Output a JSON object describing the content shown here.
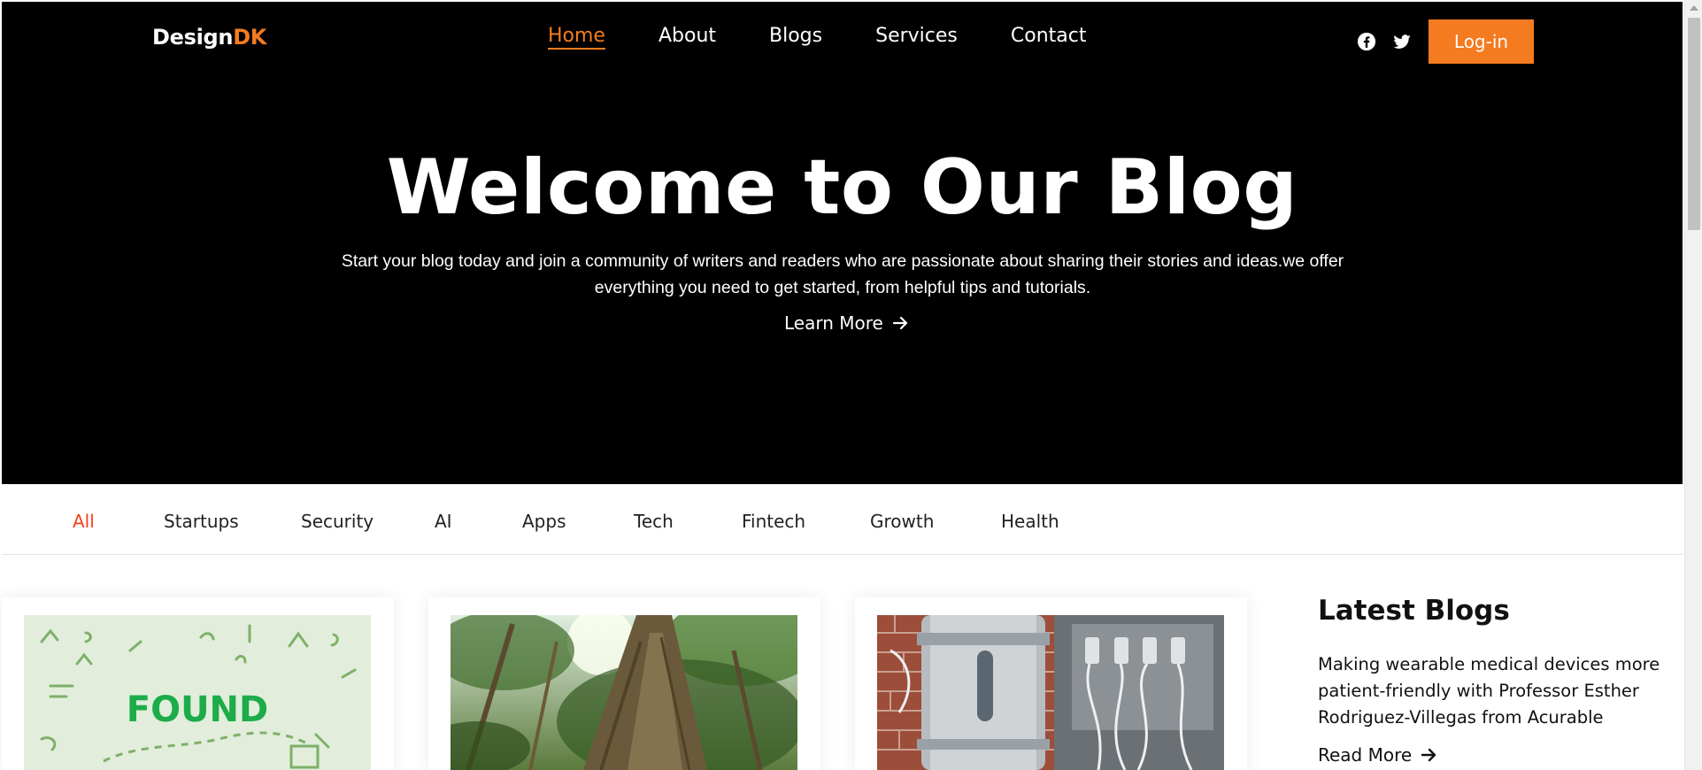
{
  "header": {
    "logo_main": "Design",
    "logo_accent": "DK",
    "nav": [
      {
        "label": "Home"
      },
      {
        "label": "About"
      },
      {
        "label": "Blogs"
      },
      {
        "label": "Services"
      },
      {
        "label": "Contact"
      }
    ],
    "login_label": "Log-in",
    "social_icons": [
      "facebook-icon",
      "twitter-icon"
    ]
  },
  "hero": {
    "title": "Welcome to Our Blog",
    "subtitle": "Start your blog today and join a community of writers and readers who are passionate about sharing their stories and ideas.we offer everything you need to get started, from helpful tips and tutorials.",
    "cta_label": "Learn More"
  },
  "categories": [
    {
      "label": "All"
    },
    {
      "label": "Startups"
    },
    {
      "label": "Security"
    },
    {
      "label": "AI"
    },
    {
      "label": "Apps"
    },
    {
      "label": "Tech"
    },
    {
      "label": "Fintech"
    },
    {
      "label": "Growth"
    },
    {
      "label": "Health"
    }
  ],
  "cards": [
    {
      "image_text": "FOUND"
    },
    {
      "image_text": ""
    },
    {
      "image_text": ""
    }
  ],
  "latest": {
    "title": "Latest Blogs",
    "item_title": "Making wearable medical devices more patient-friendly with Professor Esther Rodriguez-Villegas from Acurable",
    "read_more_label": "Read More"
  },
  "colors": {
    "accent": "#f47b20",
    "active_category": "#f5421b",
    "hero_bg": "#000000"
  }
}
